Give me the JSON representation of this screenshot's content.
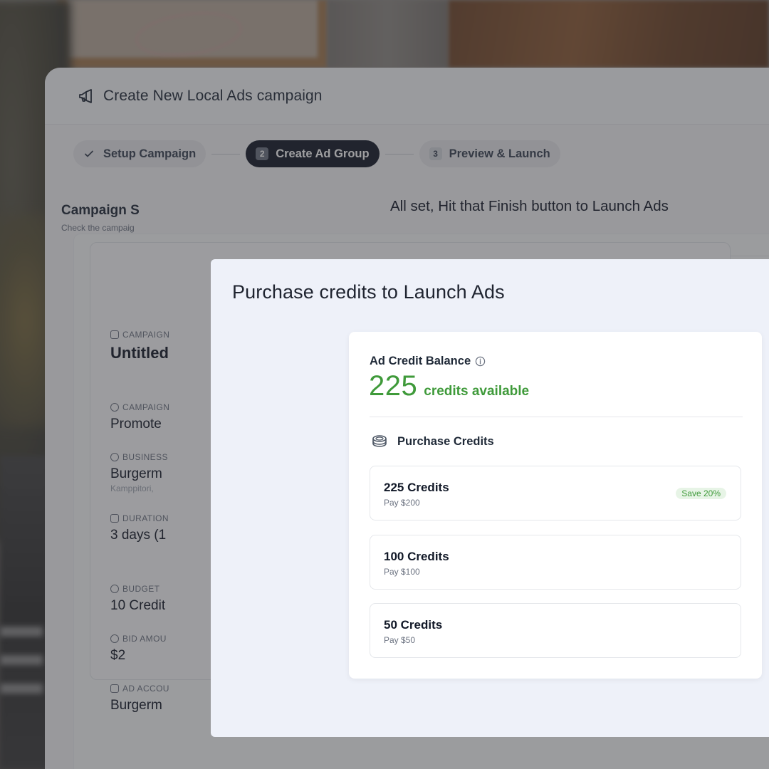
{
  "window": {
    "title": "Create New Local Ads campaign"
  },
  "stepper": {
    "steps": [
      {
        "number": "",
        "label": "Setup Campaign",
        "state": "done"
      },
      {
        "number": "2",
        "label": "Create Ad Group",
        "state": "active"
      },
      {
        "number": "3",
        "label": "Preview & Launch",
        "state": "pending"
      }
    ]
  },
  "hint": "All set, Hit that Finish button to Launch Ads",
  "summary": {
    "title": "Campaign S",
    "subtitle": "Check the campaig",
    "fields": [
      {
        "label": "CAMPAIGN",
        "value": "Untitled"
      },
      {
        "label": "CAMPAIGN",
        "value": "Promote"
      },
      {
        "label": "BUSINESS",
        "value": "Burgerm",
        "note": "Kamppitori,"
      },
      {
        "label": "DURATION",
        "value": "3 days (1"
      },
      {
        "label": "BUDGET",
        "value": "10 Credit"
      },
      {
        "label": "BID AMOU",
        "value": "$2"
      },
      {
        "label": "AD ACCOU",
        "value": "Burgerm"
      }
    ]
  },
  "modal": {
    "title": "Purchase credits to Launch Ads",
    "balance_label": "Ad Credit Balance",
    "balance_value": "225",
    "balance_unit": "credits available",
    "purchase_label": "Purchase Credits",
    "options": [
      {
        "title": "225 Credits",
        "price": "Pay $200",
        "badge": "Save 20%"
      },
      {
        "title": "100 Credits",
        "price": "Pay $100",
        "badge": ""
      },
      {
        "title": "50 Credits",
        "price": "Pay $50",
        "badge": ""
      }
    ]
  },
  "colors": {
    "accent_green": "#3f9a3a",
    "active_step": "#111827",
    "modal_bg": "#eef1f9"
  }
}
